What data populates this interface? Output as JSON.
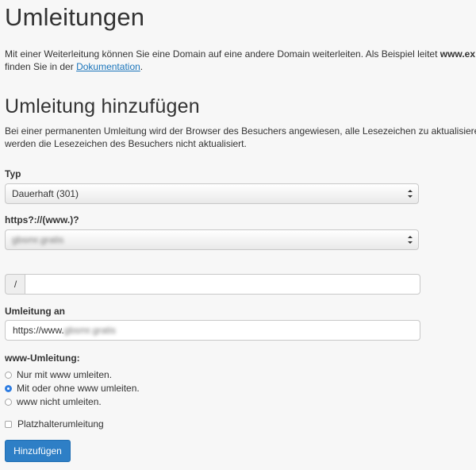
{
  "page": {
    "title": "Umleitungen",
    "intro_text": "Mit einer Weiterleitung können Sie eine Domain auf eine andere Domain weiterleiten. Als Beispiel leitet",
    "intro_bold": "www.ex",
    "intro_line2": "finden Sie in der",
    "doc_link": "Dokumentation",
    "intro_end": "."
  },
  "section": {
    "title": "Umleitung hinzufügen",
    "desc_line1": "Bei einer permanenten Umleitung wird der Browser des Besuchers angewiesen, alle Lesezeichen zu aktualisieren",
    "desc_line2": "werden die Lesezeichen des Besuchers nicht aktualisiert."
  },
  "form": {
    "type_label": "Typ",
    "type_value": "Dauerhaft (301)",
    "domain_label": "https?://(www.)?",
    "domain_value": "gbsmr.gratis",
    "path_prefix": "/",
    "path_value": "",
    "target_label": "Umleitung an",
    "target_value_prefix": "https://www.",
    "target_value_blur": "gbsmr.gratis",
    "www_label": "www-Umleitung:",
    "radio_options": [
      {
        "label": "Nur mit www umleiten.",
        "selected": false
      },
      {
        "label": "Mit oder ohne www umleiten.",
        "selected": true
      },
      {
        "label": "www nicht umleiten.",
        "selected": false
      }
    ],
    "wildcard_label": "Platzhalterumleitung",
    "wildcard_checked": false,
    "submit_label": "Hinzufügen"
  },
  "colors": {
    "background": "#f7f7f7",
    "link": "#1b75bb",
    "primary_button": "#2e7fc6",
    "radio_selected": "#2f7de1"
  }
}
